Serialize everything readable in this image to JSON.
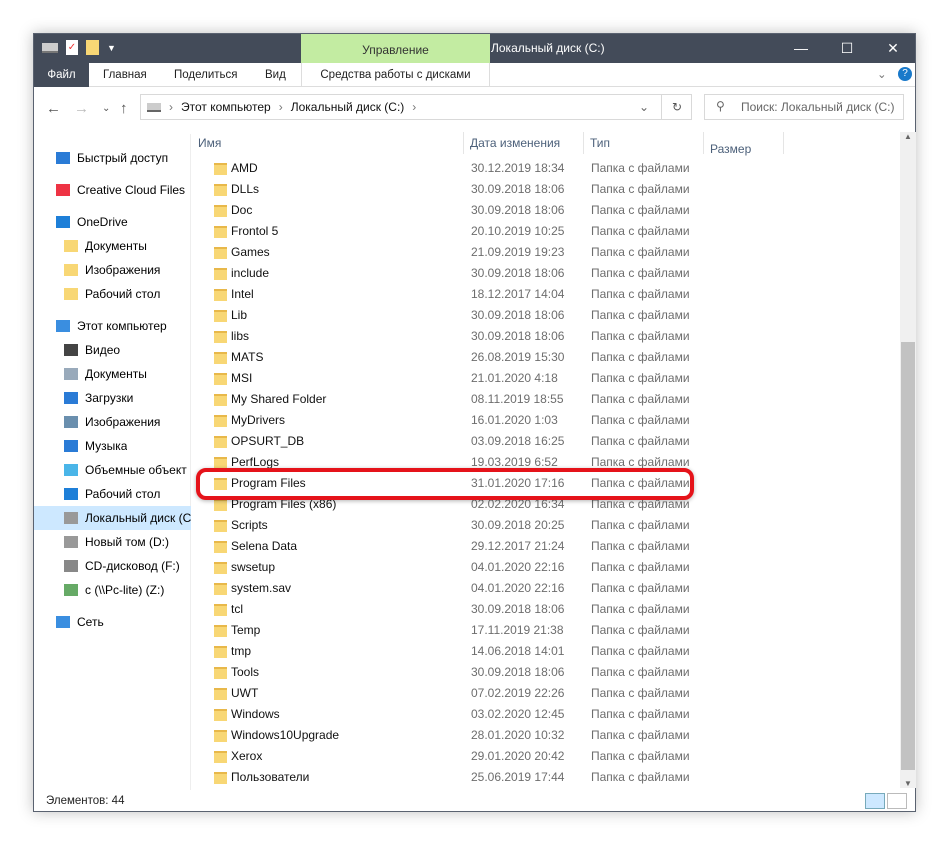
{
  "window": {
    "title": "Локальный диск (C:)",
    "context_tab": "Управление",
    "minimize": "—",
    "maximize": "☐",
    "close": "✕"
  },
  "ribbon": {
    "tabs": [
      "Файл",
      "Главная",
      "Поделиться",
      "Вид",
      "Средства работы с дисками"
    ]
  },
  "address": {
    "path": [
      "Этот компьютер",
      "Локальный диск (C:)"
    ],
    "search_placeholder": "Поиск: Локальный диск (C:)"
  },
  "sidebar": [
    {
      "label": "Быстрый доступ",
      "icon": "star-icon"
    },
    {
      "label": "Creative Cloud Files",
      "icon": "creative-cloud-icon"
    },
    {
      "label": "OneDrive",
      "icon": "cloud-icon"
    },
    {
      "label": "Документы",
      "icon": "folder-icon"
    },
    {
      "label": "Изображения",
      "icon": "folder-icon"
    },
    {
      "label": "Рабочий стол",
      "icon": "folder-icon"
    },
    {
      "label": "Этот компьютер",
      "icon": "computer-icon"
    },
    {
      "label": "Видео",
      "icon": "video-icon"
    },
    {
      "label": "Документы",
      "icon": "documents-icon"
    },
    {
      "label": "Загрузки",
      "icon": "download-icon"
    },
    {
      "label": "Изображения",
      "icon": "pictures-icon"
    },
    {
      "label": "Музыка",
      "icon": "music-icon"
    },
    {
      "label": "Объемные объект",
      "icon": "3d-icon"
    },
    {
      "label": "Рабочий стол",
      "icon": "desktop-icon"
    },
    {
      "label": "Локальный диск (C",
      "icon": "drive-icon",
      "selected": true
    },
    {
      "label": "Новый том (D:)",
      "icon": "drive-icon"
    },
    {
      "label": "CD-дисковод (F:)",
      "icon": "cd-icon"
    },
    {
      "label": "c (\\\\Pc-lite) (Z:)",
      "icon": "network-drive-icon"
    },
    {
      "label": "Сеть",
      "icon": "network-icon"
    }
  ],
  "columns": [
    "Имя",
    "Дата изменения",
    "Тип",
    "Размер"
  ],
  "files": [
    [
      "AMD",
      "30.12.2019 18:34"
    ],
    [
      "DLLs",
      "30.09.2018 18:06"
    ],
    [
      "Doc",
      "30.09.2018 18:06"
    ],
    [
      "Frontol 5",
      "20.10.2019 10:25"
    ],
    [
      "Games",
      "21.09.2019 19:23"
    ],
    [
      "include",
      "30.09.2018 18:06"
    ],
    [
      "Intel",
      "18.12.2017 14:04"
    ],
    [
      "Lib",
      "30.09.2018 18:06"
    ],
    [
      "libs",
      "30.09.2018 18:06"
    ],
    [
      "MATS",
      "26.08.2019 15:30"
    ],
    [
      "MSI",
      "21.01.2020 4:18"
    ],
    [
      "My Shared Folder",
      "08.11.2019 18:55"
    ],
    [
      "MyDrivers",
      "16.01.2020 1:03"
    ],
    [
      "OPSURT_DB",
      "03.09.2018 16:25"
    ],
    [
      "PerfLogs",
      "19.03.2019 6:52"
    ],
    [
      "Program Files",
      "31.01.2020 17:16"
    ],
    [
      "Program Files (x86)",
      "02.02.2020 16:34"
    ],
    [
      "Scripts",
      "30.09.2018 20:25"
    ],
    [
      "Selena Data",
      "29.12.2017 21:24"
    ],
    [
      "swsetup",
      "04.01.2020 22:16"
    ],
    [
      "system.sav",
      "04.01.2020 22:16"
    ],
    [
      "tcl",
      "30.09.2018 18:06"
    ],
    [
      "Temp",
      "17.11.2019 21:38"
    ],
    [
      "tmp",
      "14.06.2018 14:01"
    ],
    [
      "Tools",
      "30.09.2018 18:06"
    ],
    [
      "UWT",
      "07.02.2019 22:26"
    ],
    [
      "Windows",
      "03.02.2020 12:45"
    ],
    [
      "Windows10Upgrade",
      "28.01.2020 10:32"
    ],
    [
      "Xerox",
      "29.01.2020 20:42"
    ],
    [
      "Пользователи",
      "25.06.2019 17:44"
    ]
  ],
  "file_type": "Папка с файлами",
  "highlighted": "Program Files",
  "status": {
    "count": "Элементов: 44"
  }
}
